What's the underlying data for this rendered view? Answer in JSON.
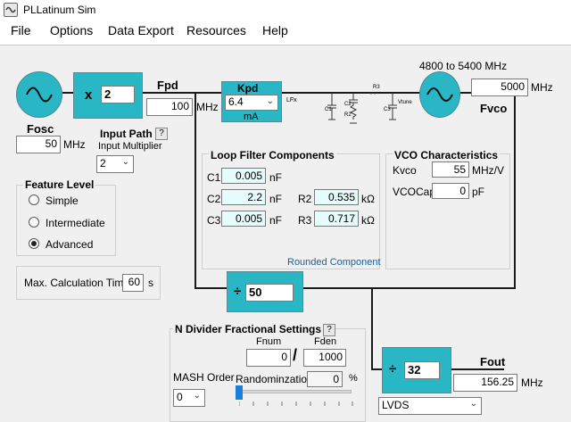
{
  "window": {
    "title": "PLLatinum Sim"
  },
  "menu": {
    "items": [
      "File",
      "Options",
      "Data Export",
      "Resources",
      "Help"
    ]
  },
  "osc": {
    "label": "Fosc",
    "value": "50",
    "unit": "MHz"
  },
  "multiplier": {
    "prefix": "x",
    "value": "2"
  },
  "fpd": {
    "label": "Fpd",
    "value": "100",
    "unit": "MHz"
  },
  "input_path": {
    "title": "Input Path",
    "help": "?",
    "sub_label": "Input Multiplier",
    "selected": "2"
  },
  "kpd": {
    "label": "Kpd",
    "selected": "6.4",
    "unit": "mA"
  },
  "schematic": {
    "lfx": "LFx",
    "r3": "R3",
    "r2": "R2",
    "c1": "C1",
    "c2": "C2",
    "c3": "C3",
    "vtune": "Vtune"
  },
  "vco": {
    "range": "4800 to 5400 MHz",
    "value": "5000",
    "unit": "MHz",
    "label": "Fvco"
  },
  "feature_level": {
    "title": "Feature Level",
    "options": [
      "Simple",
      "Intermediate",
      "Advanced"
    ],
    "selected": "Advanced"
  },
  "calc_time": {
    "label": "Max. Calculation Time",
    "value": "60",
    "unit": "s"
  },
  "loop_filter": {
    "title": "Loop Filter Components",
    "c1": {
      "label": "C1",
      "value": "0.005",
      "unit": "nF"
    },
    "c2": {
      "label": "C2",
      "value": "2.2",
      "unit": "nF"
    },
    "c3": {
      "label": "C3",
      "value": "0.005",
      "unit": "nF"
    },
    "r2": {
      "label": "R2",
      "value": "0.535",
      "unit": "kΩ"
    },
    "r3": {
      "label": "R3",
      "value": "0.717",
      "unit": "kΩ"
    },
    "footer": "Rounded Component"
  },
  "vco_char": {
    "title": "VCO Characteristics",
    "kvco": {
      "label": "Kvco",
      "value": "55",
      "unit": "MHz/V"
    },
    "vcocap": {
      "label": "VCOCap",
      "value": "0",
      "unit": "pF"
    }
  },
  "n_divider": {
    "prefix": "÷",
    "value": "50"
  },
  "n_frac": {
    "title": "N Divider Fractional Settings",
    "help": "?",
    "fnum_label": "Fnum",
    "fden_label": "Fden",
    "fnum": "0",
    "slash": "/",
    "fden": "1000",
    "mash_label": "MASH Order",
    "mash_selected": "0",
    "random_label": "Randominzation",
    "random_value": "0",
    "random_unit": "%"
  },
  "out_divider": {
    "prefix": "÷",
    "value": "32"
  },
  "fout": {
    "label": "Fout",
    "value": "156.25",
    "unit": "MHz"
  },
  "output_format": {
    "selected": "LVDS"
  },
  "colors": {
    "accent": "#29b6c5",
    "readonly_field": "#e6fbfb",
    "footer_text": "#1a5f96"
  }
}
